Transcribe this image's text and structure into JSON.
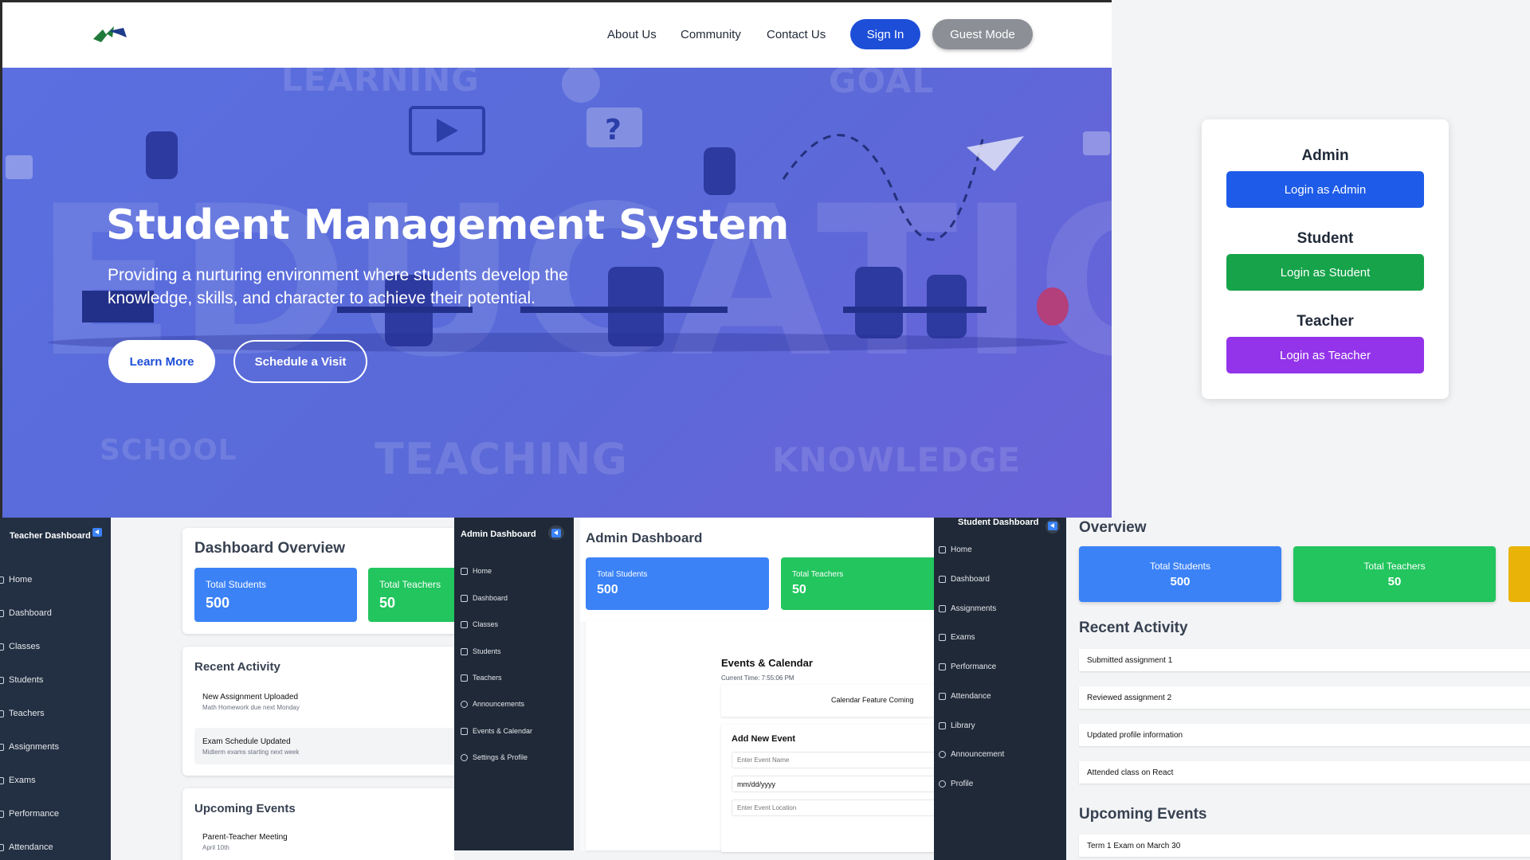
{
  "landing": {
    "nav": {
      "about": "About Us",
      "community": "Community",
      "contact": "Contact Us",
      "signin": "Sign In",
      "guest": "Guest Mode"
    },
    "hero": {
      "watermarks": {
        "learning": "LEARNING",
        "goal": "GOAL",
        "education": "EDUCATION",
        "school": "SCHOOL",
        "teaching": "TEACHING",
        "knowledge": "KNOWLEDGE"
      },
      "title": "Student Management System",
      "subtitle": "Providing a nurturing environment where students develop the knowledge, skills, and character to achieve their potential.",
      "learn_more": "Learn More",
      "schedule": "Schedule a Visit"
    }
  },
  "login": {
    "admin_title": "Admin",
    "admin_btn": "Login as Admin",
    "student_title": "Student",
    "student_btn": "Login as Student",
    "teacher_title": "Teacher",
    "teacher_btn": "Login as Teacher"
  },
  "teacher": {
    "sidebar_title": "Teacher Dashboard",
    "menu": [
      "Home",
      "Dashboard",
      "Classes",
      "Students",
      "Teachers",
      "Assignments",
      "Exams",
      "Performance",
      "Attendance"
    ],
    "overview_title": "Dashboard Overview",
    "stats": [
      {
        "label": "Total Students",
        "value": "500"
      },
      {
        "label": "Total Teachers",
        "value": "50"
      }
    ],
    "recent_title": "Recent Activity",
    "activity": [
      {
        "title": "New Assignment Uploaded",
        "sub": "Math Homework due next Monday"
      },
      {
        "title": "Exam Schedule Updated",
        "sub": "Midterm exams starting next week"
      }
    ],
    "upcoming_title": "Upcoming Events",
    "events": [
      {
        "title": "Parent-Teacher Meeting",
        "sub": "April 10th"
      }
    ]
  },
  "admin": {
    "sidebar_title": "Admin Dashboard",
    "menu": [
      "Home",
      "Dashboard",
      "Classes",
      "Students",
      "Teachers",
      "Announcements",
      "Events & Calendar",
      "Settings & Profile"
    ],
    "title": "Admin Dashboard",
    "stats": [
      {
        "label": "Total Students",
        "value": "500"
      },
      {
        "label": "Total Teachers",
        "value": "50"
      }
    ],
    "events_title": "Events & Calendar",
    "current_time": "Current Time: 7:55:06 PM",
    "calendar_coming": "Calendar Feature Coming",
    "add_event_title": "Add New Event",
    "event_name_placeholder": "Enter Event Name",
    "date_value": "mm/dd/yyyy",
    "event_location_placeholder": "Enter Event Location"
  },
  "student": {
    "sidebar_title": "Student Dashboard",
    "menu": [
      "Home",
      "Dashboard",
      "Assignments",
      "Exams",
      "Performance",
      "Attendance",
      "Library",
      "Announcement",
      "Profile"
    ],
    "overview_title": "Overview",
    "stats": [
      {
        "label": "Total Students",
        "value": "500"
      },
      {
        "label": "Total Teachers",
        "value": "50"
      }
    ],
    "recent_title": "Recent Activity",
    "activity": [
      "Submitted assignment 1",
      "Reviewed assignment 2",
      "Updated profile information",
      "Attended class on React"
    ],
    "upcoming_title": "Upcoming Events",
    "events": [
      "Term 1 Exam on March 30"
    ]
  },
  "colors": {
    "blue": "#3b82f6",
    "green": "#22c55e",
    "yellow": "#eab308",
    "sidebar": "#233043",
    "purple": "#9333ea"
  }
}
